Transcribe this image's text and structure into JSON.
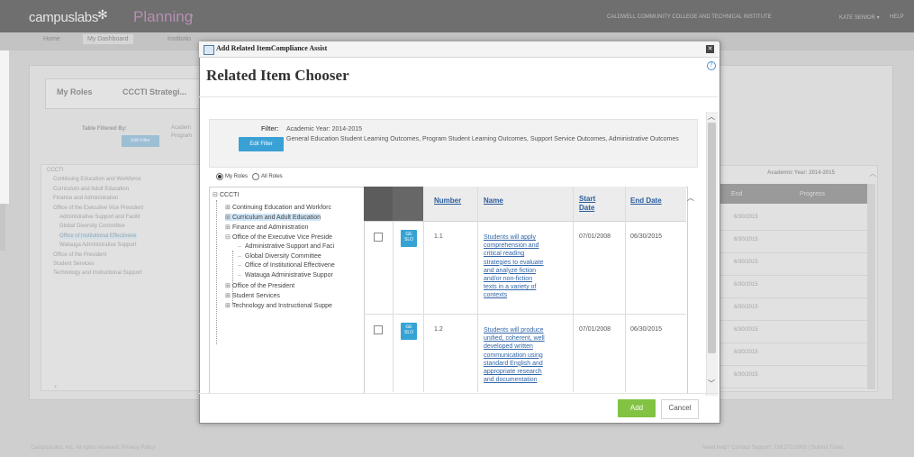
{
  "app": {
    "logo": "campuslabs",
    "product": "Planning",
    "institution": "CALDWELL COMMUNITY COLLEGE AND TECHNICAL INSTITUTE",
    "user": "KATE SENIOR ▾",
    "help": "HELP"
  },
  "nav": {
    "tabs": [
      "Home",
      "My Dashboard",
      "Institutio"
    ]
  },
  "background": {
    "roles_tab": "My Roles",
    "strategic_tab": "CCCTI Strategi...",
    "table_filtered_by": "Table Filtered By:",
    "filter_snip_1": "Academ",
    "filter_snip_2": "Program",
    "edit_filter": "Edit Filter",
    "tree_items": [
      "CCCTI",
      "Continuing Education and Workforce",
      "Curriculum and Adult Education",
      "Finance and Administration",
      "Office of the Executive Vice President",
      "Administrative Support and Facilit",
      "Global Diversity Committee",
      "Office of Institutional Effectivene",
      "Watauga Administrative Support",
      "Office of the President",
      "Student Services",
      "Technology and Instructional Support"
    ],
    "academic_year": "Academic Year: 2014-2015",
    "col_end": "End",
    "col_progress": "Progress",
    "end_dates": [
      "6/30/2015",
      "6/30/2015",
      "6/30/2015",
      "6/30/2015",
      "6/30/2015",
      "6/30/2015",
      "6/30/2015",
      "6/30/2015"
    ],
    "footer_left": "CampusLabs, Inc. All rights reserved. Privacy Policy",
    "footer_right": "Need help? Contact Support: 716.270.0000 | Submit Ticket"
  },
  "modal": {
    "window_title": "Add Related ItemCompliance Assist",
    "close": "✕",
    "help": "?",
    "heading": "Related Item Chooser",
    "filter": {
      "label": "Filter:",
      "year": "Academic Year: 2014-2015",
      "outcomes": "General Education Student Learning Outcomes, Program Student Learning Outcomes, Support Service Outcomes, Administrative Outcomes",
      "edit_button": "Edit Filter"
    },
    "roles": {
      "my_roles": "My Roles",
      "all_roles": "All Roles"
    },
    "tree": {
      "root": "CCCTI",
      "items": [
        "Continuing Education and Workforc",
        "Curriculum and Adult Education",
        "Finance and Administration",
        "Office of the Executive Vice Preside",
        "Administrative Support and Faci",
        "Global Diversity Committee",
        "Office of Institutional Effectivene",
        "Watauga Administrative Suppor",
        "Office of the President",
        "Student Services",
        "Technology and Instructional Suppe"
      ]
    },
    "grid": {
      "columns": [
        "Number",
        "Name",
        "Start Date",
        "End Date"
      ],
      "rows": [
        {
          "badge": "GE SLO",
          "number": "1.1",
          "name": "Students will apply comprehension and critical reading strategies to evaluate and analyze fiction and/or non-fiction texts in a variety of contexts",
          "name_lines": [
            "Students will apply",
            "comprehension and",
            "critical reading",
            "strategies to evaluate",
            "and analyze fiction",
            "and/or non-fiction",
            "texts in a variety of",
            "contexts"
          ],
          "start": "07/01/2008",
          "end": "06/30/2015"
        },
        {
          "badge": "GE SLO",
          "number": "1.2",
          "name": "Students will produce unified, coherent, well developed written communication using standard English and appropriate research and documentation",
          "name_lines": [
            "Students will produce",
            "unified, coherent, well",
            "developed written",
            "communication using",
            "standard English and",
            "appropriate research",
            "and documentation"
          ],
          "start": "07/01/2008",
          "end": "06/30/2015"
        }
      ]
    },
    "buttons": {
      "add": "Add",
      "cancel": "Cancel"
    }
  }
}
